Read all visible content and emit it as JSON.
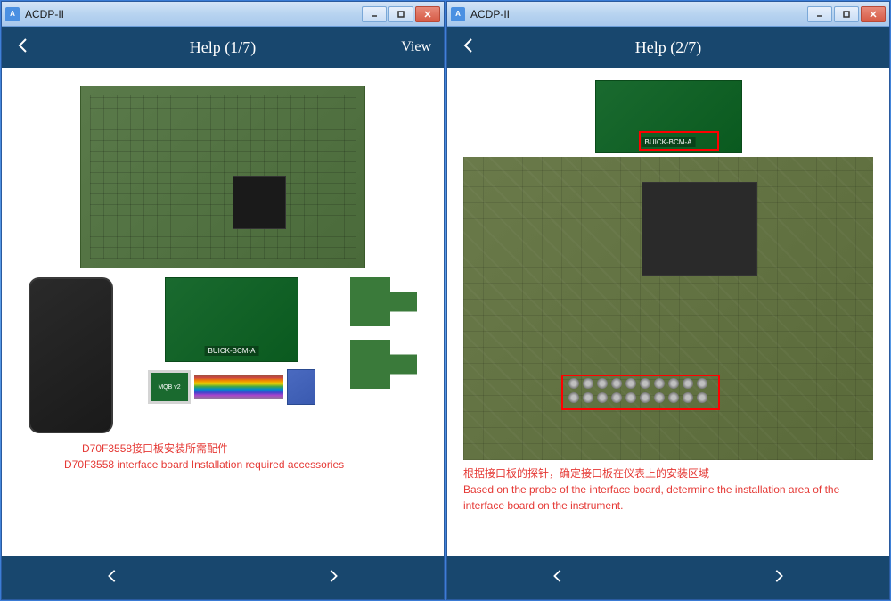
{
  "app_title": "ACDP-II",
  "windows": [
    {
      "header_title": "Help (1/7)",
      "view_label": "View",
      "caption_cn": "D70F3558接口板安装所需配件",
      "caption_en": "D70F3558 interface board Installation required accessories",
      "mqb_label": "MQB v2",
      "board_label": "BUICK-BCM-A"
    },
    {
      "header_title": "Help (2/7)",
      "caption_cn": "根据接口板的探针，确定接口板在仪表上的安装区域",
      "caption_en": "Based on the probe of the interface board, determine the installation area of the interface board on the instrument.",
      "board_label": "BUICK-BCM-A"
    }
  ]
}
